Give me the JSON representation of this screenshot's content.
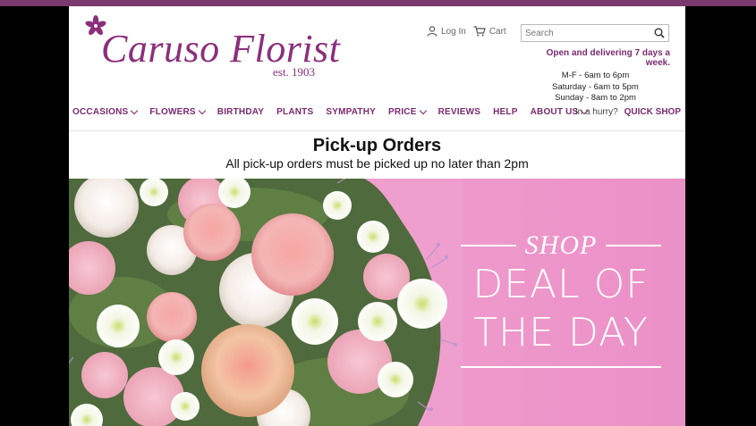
{
  "brand": {
    "name": "Caruso Florist",
    "est": "est. 1903",
    "color": "#8b2f7c"
  },
  "account": {
    "login_label": "Log In",
    "cart_label": "Cart",
    "login_icon": "user-icon",
    "cart_icon": "cart-icon"
  },
  "search": {
    "placeholder": "Search",
    "value": "",
    "icon": "search-icon"
  },
  "hours": {
    "lead": "Open and delivering 7 days a week.",
    "lines": [
      "M-F - 6am to 6pm",
      "Saturday - 6am to 5pm",
      "Sunday - 8am to 2pm"
    ]
  },
  "nav": {
    "items": [
      {
        "label": "OCCASIONS",
        "dropdown": true
      },
      {
        "label": "FLOWERS",
        "dropdown": true
      },
      {
        "label": "BIRTHDAY",
        "dropdown": false
      },
      {
        "label": "PLANTS",
        "dropdown": false
      },
      {
        "label": "SYMPATHY",
        "dropdown": false
      },
      {
        "label": "PRICE",
        "dropdown": true
      },
      {
        "label": "REVIEWS",
        "dropdown": false
      },
      {
        "label": "HELP",
        "dropdown": false
      },
      {
        "label": "ABOUT US",
        "dropdown": true
      }
    ],
    "hurry_text": "In a hurry?",
    "quick_shop_label": "QUICK SHOP",
    "accent": "#7a2a6f"
  },
  "notice": {
    "title": "Pick-up Orders",
    "subtitle": "All pick-up orders must be picked up no later than 2pm"
  },
  "banner": {
    "shop_text": "SHOP",
    "line1": "DEAL OF",
    "line2": "THE DAY",
    "background": "#ec90c8"
  }
}
